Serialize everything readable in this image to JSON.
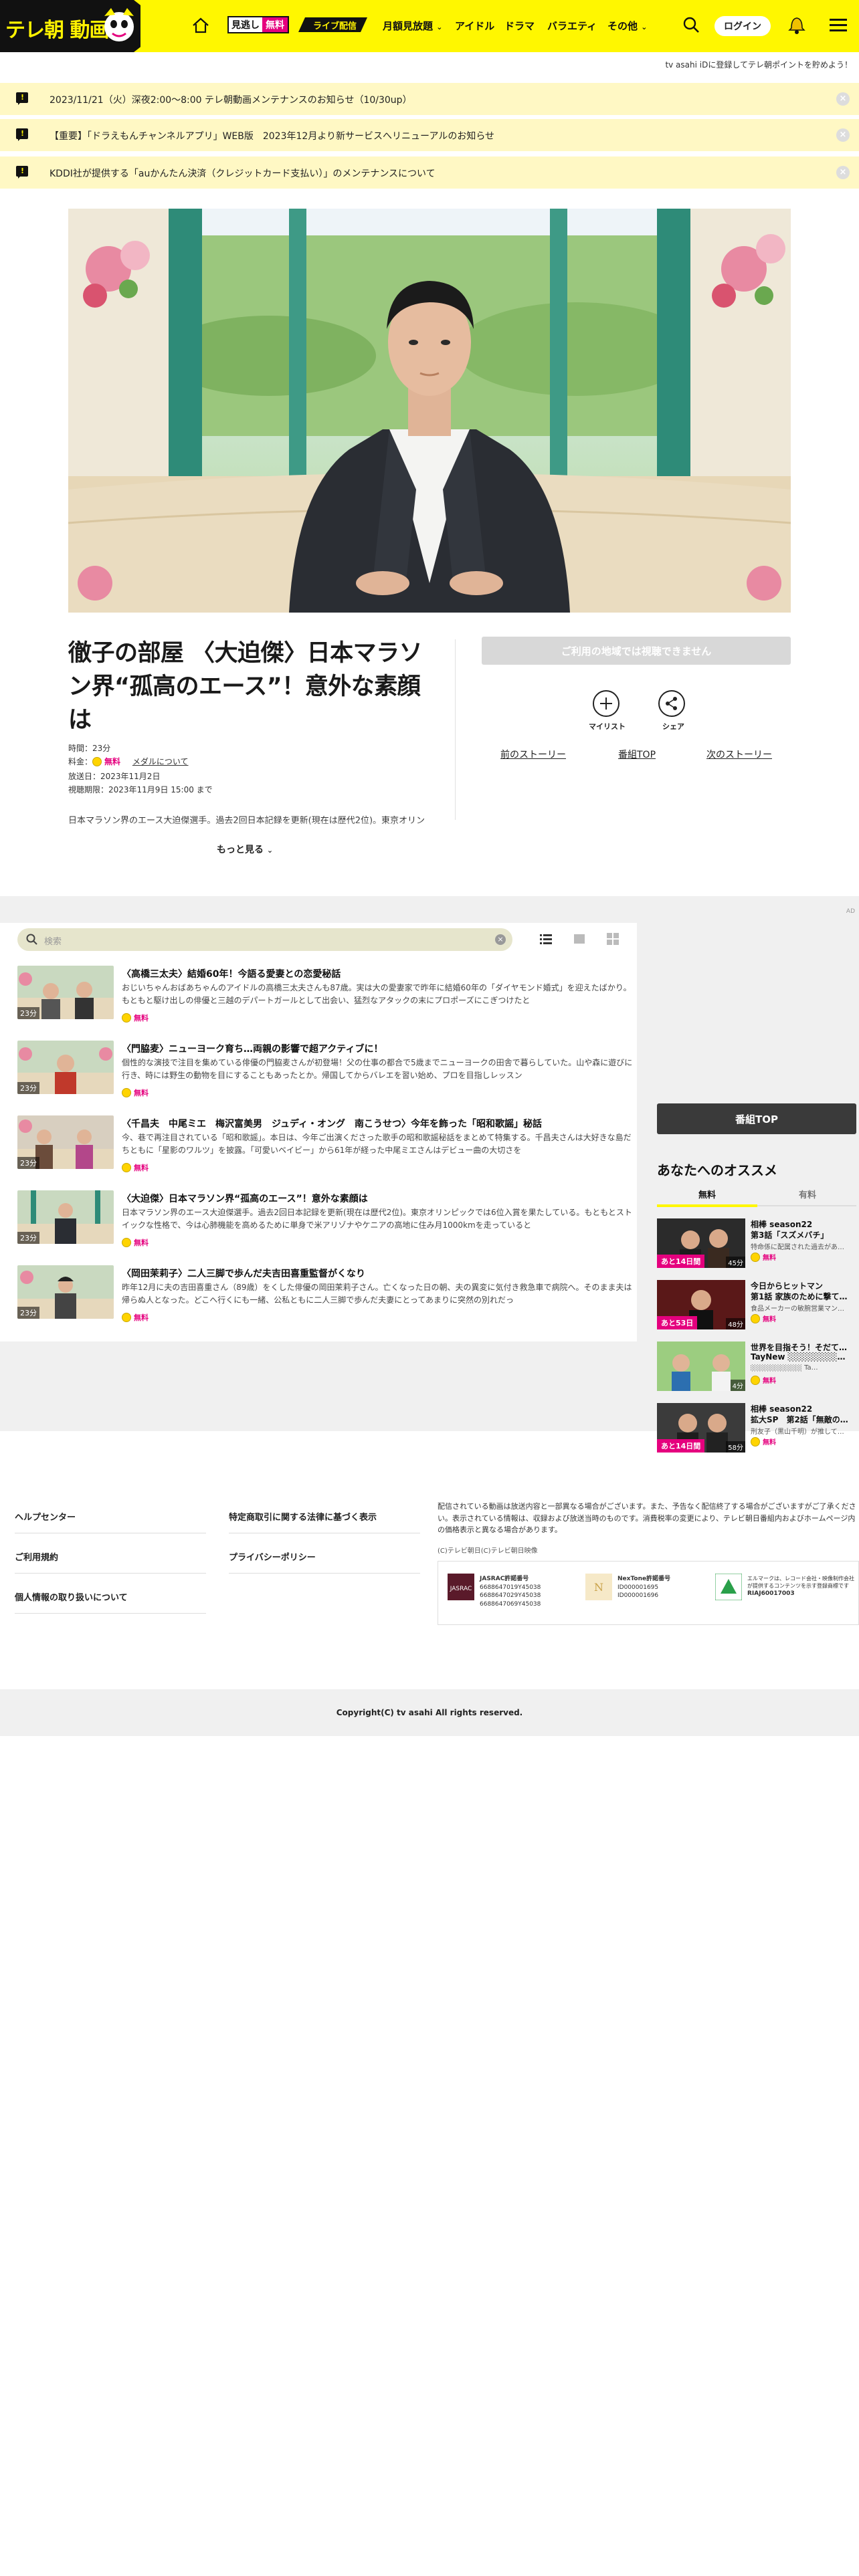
{
  "header": {
    "logo_text": "テレ朝 動画",
    "nav": {
      "mitsuke_a": "見逃し",
      "mitsuke_b": "無料",
      "live": "ライブ配信",
      "monthly": "月額見放題",
      "idol": "アイドル",
      "drama": "ドラマ",
      "variety": "バラエティ",
      "other": "その他"
    },
    "login": "ログイン",
    "icons": [
      "home-icon",
      "search-icon",
      "bell-icon",
      "menu-icon"
    ]
  },
  "tvpoint": "tv asahi iDに登録してテレ朝ポイントを貯めよう！",
  "notices": [
    {
      "text": "2023/11/21（火）深夜2:00〜8:00 テレ朝動画メンテナンスのお知らせ（10/30up）"
    },
    {
      "text": "【重要】「ドラえもんチャンネルアプリ」WEB版　2023年12月より新サービスへリニューアルのお知らせ"
    },
    {
      "text": "KDDI社が提供する「auかんたん決済（クレジットカード支払い）」のメンテナンスについて"
    }
  ],
  "program": {
    "title": "徹子の部屋 〈大迫傑〉日本マラソン界“孤高のエース”！意外な素顔は",
    "duration": "時間：23分",
    "price_label": "料金：",
    "price": "無料",
    "medal_link": "メダルについて",
    "aired": "放送日：2023年11月2日",
    "expires": "視聴期限：2023年11月9日 15:00 まで",
    "description": "日本マラソン界のエース大迫傑選手。過去2回日本記録を更新(現在は歴代2位)。東京オリン",
    "more": "もっと見る"
  },
  "actions": {
    "cant_watch": "ご利用の地域では視聴できません",
    "mylist": "マイリスト",
    "share": "シェア",
    "prev_story": "前のストーリー",
    "program_top": "番組TOP",
    "next_story": "次のストーリー"
  },
  "episode_list": {
    "search_placeholder": "検索",
    "episodes": [
      {
        "title": "〈高橋三太夫〉結婚60年！今語る愛妻との恋愛秘話",
        "desc": "おじいちゃんおばあちゃんのアイドルの高橋三太夫さんも87歳。実は大の愛妻家で昨年に結婚60年の「ダイヤモンド婚式」を迎えたばかり。もともと駆け出しの俳優と三越のデパートガールとして出会い、猛烈なアタックの末にプロポーズにこぎつけたと",
        "duration": "23分",
        "badge": "無料"
      },
      {
        "title": "〈門脇麦〉ニューヨーク育ち…両親の影響で超アクティブに！",
        "desc": "個性的な演技で注目を集めている俳優の門脇麦さんが初登場！父の仕事の都合で5歳までニューヨークの田舎で暮らしていた。山や森に遊びに行き、時には野生の動物を目にすることもあったとか。帰国してからバレエを習い始め、プロを目指しレッスン",
        "duration": "23分",
        "badge": "無料"
      },
      {
        "title": "〈千昌夫　中尾ミエ　梅沢富美男　ジュディ・オング　南こうせつ〉今年を飾った「昭和歌謡」秘話",
        "desc": "今、巷で再注目されている「昭和歌謡」。本日は、今年ご出演くださった歌手の昭和歌謡秘話をまとめて特集する。千昌夫さんは大好きな島だちともに「星影のワルツ」を披露。「可愛いベイビー」から61年が経った中尾ミエさんはデビュー曲の大切さを",
        "duration": "23分",
        "badge": "無料"
      },
      {
        "title": "〈大迫傑〉日本マラソン界“孤高のエース”！意外な素顔は",
        "desc": "日本マラソン界のエース大迫傑選手。過去2回日本記録を更新(現在は歴代2位)。東京オリンピックでは6位入賞を果たしている。もともとストイックな性格で、今は心肺機能を高めるために単身で米アリゾナやケニアの高地に住み月1000kmを走っていると",
        "duration": "23分",
        "badge": "無料"
      },
      {
        "title": "〈岡田茉莉子〉二人三脚で歩んだ夫吉田喜重監督がくなり",
        "desc": "昨年12月に夫の吉田喜重さん（89歳）をくした俳優の岡田茉莉子さん。亡くなった日の朝、夫の異変に気付き救急車で病院へ。そのまま夫は帰らぬ人となった。どこへ行くにも一緒、公私ともに二人三脚で歩んだ夫妻にとってあまりに突然の別れだっ",
        "duration": "23分",
        "badge": "無料"
      }
    ]
  },
  "sidebar": {
    "ad_label": "AD",
    "program_top": "番組TOP",
    "recommend_title": "あなたへのオススメ",
    "tab_free": "無料",
    "tab_paid": "有料",
    "items": [
      {
        "l1": "相棒 season22",
        "l2": "第3話「スズメバチ」",
        "l3": "特命係に配属された過去があ…",
        "l4": "無料",
        "pink": "あと14日間",
        "dur": "45分"
      },
      {
        "l1": "今日からヒットマン",
        "l2": "第1話 家族のために撃て…",
        "l3": "食品メーカーの敏腕営業マン…",
        "l4": "無料",
        "pink": "あと53日",
        "dur": "48分"
      },
      {
        "l1": "世界を目指そう！そだて…",
        "l2": "TayNew ░░░░░░░░…",
        "l3": "░░░░░░░░░░ Ta…",
        "l4": "無料",
        "pink": "",
        "dur": "4分"
      },
      {
        "l1": "相棒 season22",
        "l2": "拡大SP　第2話「無敵の…",
        "l3": "刑友子（黒山千明）が推して…",
        "l4": "無料",
        "pink": "あと14日間",
        "dur": "58分"
      }
    ]
  },
  "footer": {
    "help": "ヘルプセンター",
    "terms": "ご利用規約",
    "privacy_handling": "個人情報の取り扱いについて",
    "tokutei": "特定商取引に関する法律に基づく表示",
    "privacy_policy": "プライバシーポリシー",
    "disclaimer": "配信されている動画は放送内容と一部異なる場合がございます。また、予告なく配信終了する場合がございますがご了承ください。表示されている情報は、収録および放送当時のものです。消費税率の変更により、テレビ朝日番組内およびホームページ内の価格表示と異なる場合があります。",
    "small_copy": "(C)テレビ朝日(C)テレビ朝日映像",
    "jasrac_title": "JASRAC許諾番号",
    "jasrac_nums": [
      "6688647019Y45038",
      "6688647029Y45038",
      "6688647069Y45038"
    ],
    "nextone_title": "NexTone許諾番号",
    "nextone_nums": [
      "ID000001695",
      "ID000001696"
    ],
    "lmark": "エルマークは、レコード会社・映像制作会社が提供するコンテンツを示す登録商標です",
    "lmark_num": "RIAJ60017003",
    "copyright": "Copyright(C) tv asahi All rights reserved."
  }
}
